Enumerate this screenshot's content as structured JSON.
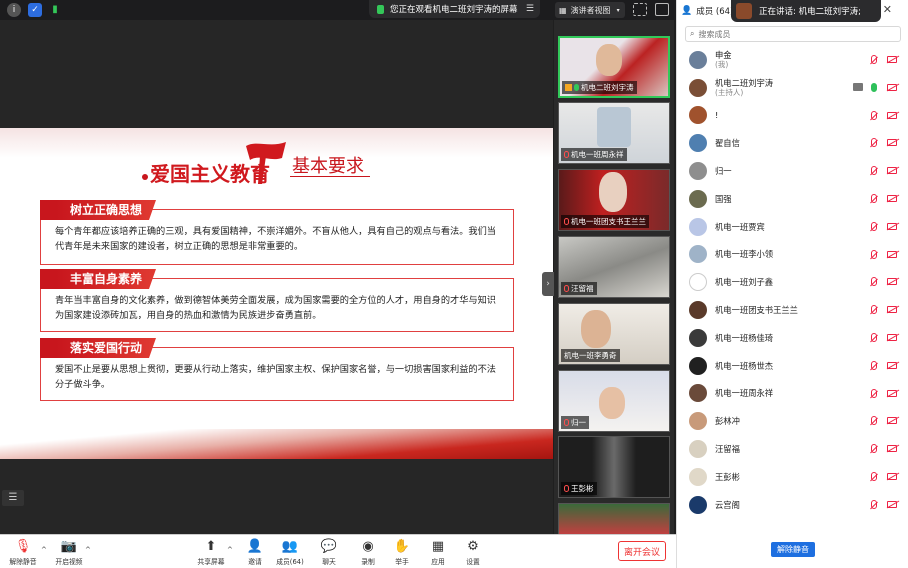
{
  "topbar": {
    "sharing_notice": "您正在观看机电二班刘宇涛的屏幕",
    "view_mode": "演讲者视图"
  },
  "slide": {
    "title": "爱国主义教育",
    "subtitle": "基本要求",
    "sections": [
      {
        "heading": "树立正确思想",
        "body": "每个青年都应该培养正确的三观，具有爱国精神，不崇洋媚外。不盲从他人，具有自己的观点与看法。我们当代青年是未来国家的建设者，树立正确的思想是非常重要的。"
      },
      {
        "heading": "丰富自身素养",
        "body": "青年当丰富自身的文化素养，做到德智体美劳全面发展，成为国家需要的全方位的人才，用自身的才华与知识为国家建设添砖加瓦，用自身的热血和激情为民族进步奋勇直前。"
      },
      {
        "heading": "落实爱国行动",
        "body": "爱国不止是要从思想上贯彻，更要从行动上落实，维护国家主权、保护国家名誉，与一切损害国家利益的不法分子做斗争。"
      }
    ]
  },
  "video_tiles": [
    {
      "name": "机电二班刘宇涛",
      "active": true
    },
    {
      "name": "机电一班周永祥"
    },
    {
      "name": "机电一班团支书王兰兰"
    },
    {
      "name": "汪留福"
    },
    {
      "name": "机电一班李勇奇"
    },
    {
      "name": "归一"
    },
    {
      "name": "王彭彬"
    },
    {
      "name": ""
    }
  ],
  "panel": {
    "title": "成员 (64)",
    "speaking": "正在讲话: 机电二班刘宇涛;",
    "search_placeholder": "搜索成员",
    "unmute_all": "解除静音",
    "members": [
      {
        "name": "申金",
        "role": "(我)",
        "color": "#6a7f9a"
      },
      {
        "name": "机电二班刘宇涛",
        "role": "(主持人)",
        "color": "#7a4e36",
        "host": true
      },
      {
        "name": "!",
        "role": "",
        "color": "#a0522d"
      },
      {
        "name": "翟自信",
        "role": "",
        "color": "#4f7fb0"
      },
      {
        "name": "归一",
        "role": "",
        "color": "#8e8e8e"
      },
      {
        "name": "国强",
        "role": "",
        "color": "#6b6b4f"
      },
      {
        "name": "机电一班贾宾",
        "role": "",
        "color": "#b9c6e6"
      },
      {
        "name": "机电一班李小领",
        "role": "",
        "color": "#9fb3c8"
      },
      {
        "name": "机电一班刘子鑫",
        "role": "",
        "color": "#ffffff"
      },
      {
        "name": "机电一班团支书王兰兰",
        "role": "",
        "color": "#5a3a2a"
      },
      {
        "name": "机电一班杨佳琦",
        "role": "",
        "color": "#3a3a3a"
      },
      {
        "name": "机电一班杨世杰",
        "role": "",
        "color": "#202020"
      },
      {
        "name": "机电一班周永祥",
        "role": "",
        "color": "#6a4a3a"
      },
      {
        "name": "彭林冲",
        "role": "",
        "color": "#c89a7a"
      },
      {
        "name": "汪留福",
        "role": "",
        "color": "#d8d0c0"
      },
      {
        "name": "王彭彬",
        "role": "",
        "color": "#e0d8c8"
      },
      {
        "name": "云宫阁",
        "role": "",
        "color": "#1a3a6a"
      }
    ]
  },
  "toolbar": {
    "mute": "解除静音",
    "video": "开启视频",
    "share": "共享屏幕",
    "invite": "邀请",
    "members": "成员(64)",
    "chat": "聊天",
    "record": "录制",
    "raise_hand": "举手",
    "apps": "应用",
    "settings": "设置",
    "leave": "离开会议"
  }
}
